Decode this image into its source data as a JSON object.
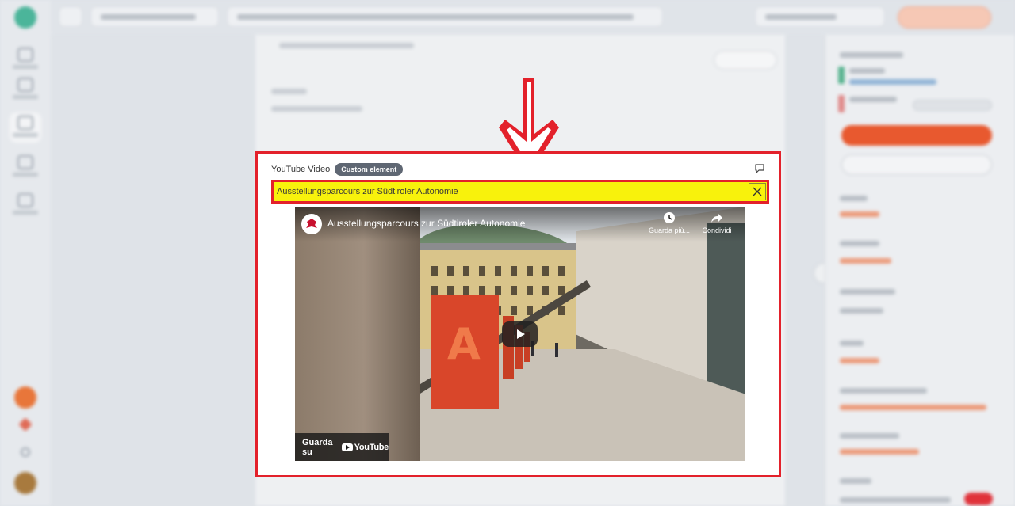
{
  "card": {
    "title": "YouTube Video",
    "tag": "Custom element",
    "video_title_field": "Ausstellungsparcours zur Südtiroler Autonomie"
  },
  "youtube": {
    "video_title": "Ausstellungsparcours zur Südtiroler Autonomie",
    "watch_later": "Guarda più...",
    "share": "Condividi",
    "watch_on": "Guarda su",
    "brand": "YouTube"
  },
  "annotation": {
    "highlight_color": "#e3212b",
    "field_highlight_fill": "#f8f20c"
  },
  "icons": {
    "comment": "comment-icon",
    "close": "close-icon",
    "clock": "clock-icon",
    "share": "share-icon",
    "play": "play-icon",
    "arrow": "down-arrow-icon"
  }
}
